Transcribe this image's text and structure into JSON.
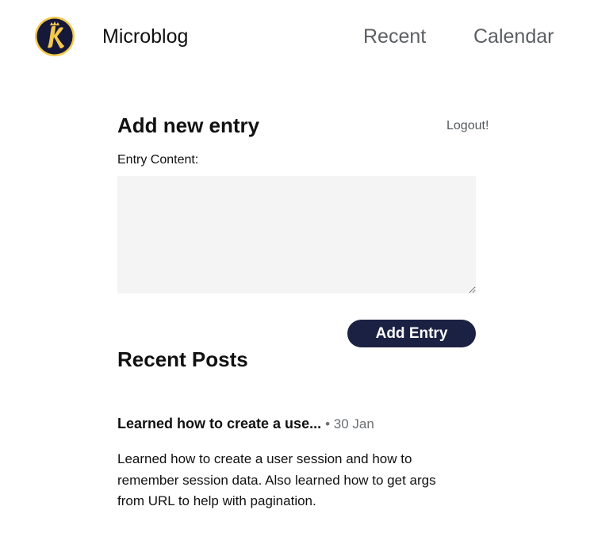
{
  "header": {
    "brand": "Microblog",
    "logo_letter": "K",
    "nav": [
      {
        "label": "Recent"
      },
      {
        "label": "Calendar"
      }
    ]
  },
  "entry_form": {
    "title": "Add new entry",
    "logout": "Logout!",
    "content_label": "Entry Content:",
    "content_value": "",
    "submit_label": "Add Entry"
  },
  "recent": {
    "heading": "Recent Posts",
    "posts": [
      {
        "title": "Learned how to create a use...",
        "date": "• 30 Jan",
        "body": "Learned how to create a user session and how to remember session data. Also learned how to get args from URL to help with pagination."
      }
    ]
  },
  "colors": {
    "button_bg": "#1b2142",
    "logo_bg": "#16183a",
    "logo_accent": "#f2c94c",
    "textarea_bg": "#f3f4f3",
    "nav_text": "#5a5f63"
  }
}
